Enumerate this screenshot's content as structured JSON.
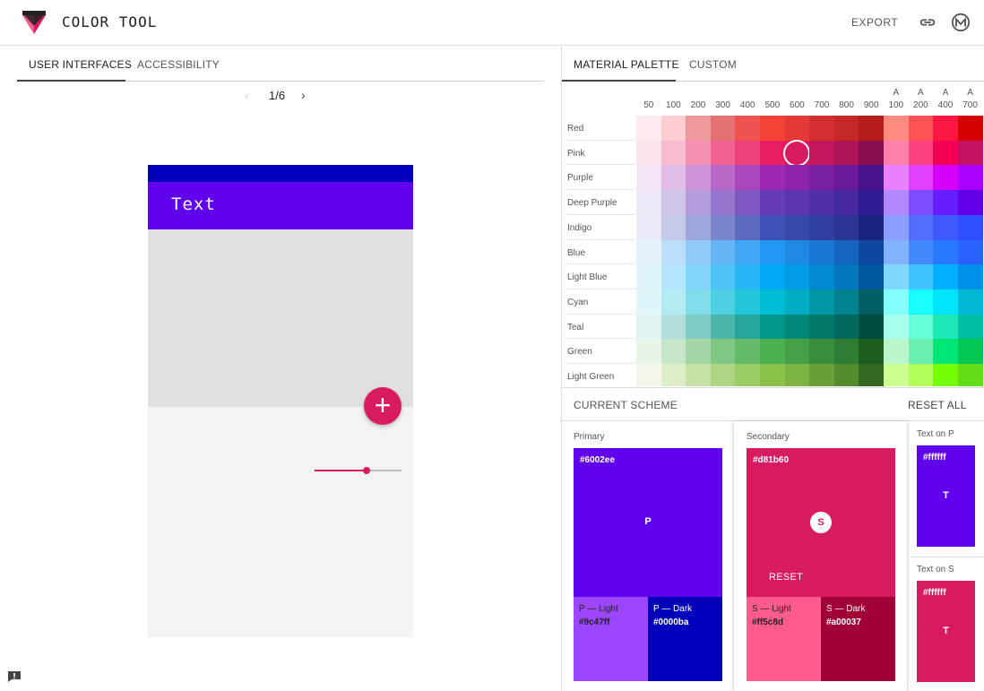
{
  "app": {
    "title": "COLOR TOOL",
    "export_label": "EXPORT",
    "link_icon": "link-icon",
    "material_icon": "material-logo-icon"
  },
  "left": {
    "tabs": [
      {
        "label": "USER INTERFACES",
        "active": true
      },
      {
        "label": "ACCESSIBILITY",
        "active": false
      }
    ],
    "pager": {
      "prev": "‹",
      "label": "1/6",
      "next": "›"
    },
    "preview": {
      "appbar_text": "Text",
      "fab_icon": "+",
      "slider_value": 0.61
    }
  },
  "right": {
    "tabs": [
      {
        "label": "MATERIAL PALETTE",
        "active": true
      },
      {
        "label": "CUSTOM",
        "active": false
      }
    ],
    "shades": [
      {
        "a": "",
        "n": "50"
      },
      {
        "a": "",
        "n": "100"
      },
      {
        "a": "",
        "n": "200"
      },
      {
        "a": "",
        "n": "300"
      },
      {
        "a": "",
        "n": "400"
      },
      {
        "a": "",
        "n": "500"
      },
      {
        "a": "",
        "n": "600"
      },
      {
        "a": "",
        "n": "700"
      },
      {
        "a": "",
        "n": "800"
      },
      {
        "a": "",
        "n": "900"
      },
      {
        "a": "A",
        "n": "100"
      },
      {
        "a": "A",
        "n": "200"
      },
      {
        "a": "A",
        "n": "400"
      },
      {
        "a": "A",
        "n": "700"
      }
    ],
    "palette": [
      {
        "name": "Red",
        "colors": [
          "#ffebee",
          "#ffcdd2",
          "#ef9a9a",
          "#e57373",
          "#ef5350",
          "#f44336",
          "#e53935",
          "#d32f2f",
          "#c62828",
          "#b71c1c",
          "#ff8a80",
          "#ff5252",
          "#ff1744",
          "#d50000"
        ]
      },
      {
        "name": "Pink",
        "colors": [
          "#fce4ec",
          "#f8bbd0",
          "#f48fb1",
          "#f06292",
          "#ec407a",
          "#e91e63",
          "#d81b60",
          "#c2185b",
          "#ad1457",
          "#880e4f",
          "#ff80ab",
          "#ff4081",
          "#f50057",
          "#c51162"
        ],
        "selected": 6
      },
      {
        "name": "Purple",
        "colors": [
          "#f3e5f5",
          "#e1bee7",
          "#ce93d8",
          "#ba68c8",
          "#ab47bc",
          "#9c27b0",
          "#8e24aa",
          "#7b1fa2",
          "#6a1b9a",
          "#4a148c",
          "#ea80fc",
          "#e040fb",
          "#d500f9",
          "#aa00ff"
        ]
      },
      {
        "name": "Deep Purple",
        "colors": [
          "#ede7f6",
          "#d1c4e9",
          "#b39ddb",
          "#9575cd",
          "#7e57c2",
          "#673ab7",
          "#5e35b1",
          "#512da8",
          "#4527a0",
          "#311b92",
          "#b388ff",
          "#7c4dff",
          "#651fff",
          "#6200ea"
        ]
      },
      {
        "name": "Indigo",
        "colors": [
          "#e8eaf6",
          "#c5cae9",
          "#9fa8da",
          "#7986cb",
          "#5c6bc0",
          "#3f51b5",
          "#3949ab",
          "#303f9f",
          "#283593",
          "#1a237e",
          "#8c9eff",
          "#536dfe",
          "#3d5afe",
          "#304ffe"
        ]
      },
      {
        "name": "Blue",
        "colors": [
          "#e3f2fd",
          "#bbdefb",
          "#90caf9",
          "#64b5f6",
          "#42a5f5",
          "#2196f3",
          "#1e88e5",
          "#1976d2",
          "#1565c0",
          "#0d47a1",
          "#82b1ff",
          "#448aff",
          "#2979ff",
          "#2962ff"
        ]
      },
      {
        "name": "Light Blue",
        "colors": [
          "#e1f5fe",
          "#b3e5fc",
          "#81d4fa",
          "#4fc3f7",
          "#29b6f6",
          "#03a9f4",
          "#039be5",
          "#0288d1",
          "#0277bd",
          "#01579b",
          "#80d8ff",
          "#40c4ff",
          "#00b0ff",
          "#0091ea"
        ]
      },
      {
        "name": "Cyan",
        "colors": [
          "#e0f7fa",
          "#b2ebf2",
          "#80deea",
          "#4dd0e1",
          "#26c6da",
          "#00bcd4",
          "#00acc1",
          "#0097a7",
          "#00838f",
          "#006064",
          "#84ffff",
          "#18ffff",
          "#00e5ff",
          "#00b8d4"
        ]
      },
      {
        "name": "Teal",
        "colors": [
          "#e0f2f1",
          "#b2dfdb",
          "#80cbc4",
          "#4db6ac",
          "#26a69a",
          "#009688",
          "#00897b",
          "#00796b",
          "#00695c",
          "#004d40",
          "#a7ffeb",
          "#64ffda",
          "#1de9b6",
          "#00bfa5"
        ]
      },
      {
        "name": "Green",
        "colors": [
          "#e8f5e9",
          "#c8e6c9",
          "#a5d6a7",
          "#81c784",
          "#66bb6a",
          "#4caf50",
          "#43a047",
          "#388e3c",
          "#2e7d32",
          "#1b5e20",
          "#b9f6ca",
          "#69f0ae",
          "#00e676",
          "#00c853"
        ]
      },
      {
        "name": "Light Green",
        "colors": [
          "#f1f8e9",
          "#dcedc8",
          "#c5e1a5",
          "#aed581",
          "#9ccc65",
          "#8bc34a",
          "#7cb342",
          "#689f38",
          "#558b2f",
          "#33691e",
          "#ccff90",
          "#b2ff59",
          "#76ff03",
          "#64dd17"
        ]
      }
    ],
    "scheme": {
      "title": "CURRENT SCHEME",
      "reset_all": "RESET ALL",
      "primary": {
        "label": "Primary",
        "hex": "#6002ee",
        "letter": "P",
        "light_name": "P — Light",
        "light_hex": "#9c47ff",
        "dark_name": "P — Dark",
        "dark_hex": "#0000ba"
      },
      "secondary": {
        "label": "Secondary",
        "hex": "#d81b60",
        "letter": "S",
        "reset": "RESET",
        "light_name": "S — Light",
        "light_hex": "#ff5c8d",
        "dark_name": "S — Dark",
        "dark_hex": "#a00037"
      },
      "text_on_p": {
        "label": "Text on P",
        "hex": "#ffffff",
        "letter": "T"
      },
      "text_on_s": {
        "label": "Text on S",
        "hex": "#ffffff",
        "letter": "T"
      }
    }
  },
  "colors": {
    "primary": "#6002ee",
    "primary_dark": "#0000ba",
    "secondary": "#d81b60"
  }
}
